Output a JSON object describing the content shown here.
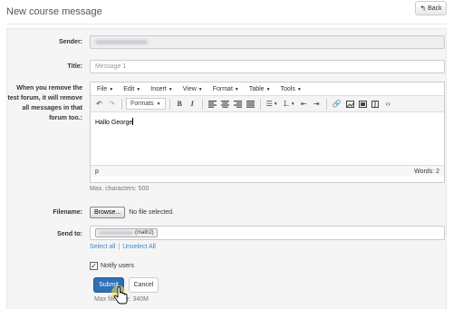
{
  "header": {
    "title": "New course message",
    "back_label": "Back"
  },
  "form": {
    "sender_label": "Sender:",
    "title_label": "Title:",
    "title_placeholder": "Message 1",
    "message_label": "When you remove the test forum, it will remove all messages in that forum too.:",
    "editor": {
      "menus": [
        "File",
        "Edit",
        "Insert",
        "View",
        "Format",
        "Table",
        "Tools"
      ],
      "formats_label": "Formats",
      "content": "Hallo George",
      "path": "p",
      "word_count": "Words: 2"
    },
    "max_chars_hint": "Max. characters: 500",
    "filename_label": "Filename:",
    "browse_label": "Browse...",
    "no_file_text": "No file selected.",
    "send_to_label": "Send to:",
    "recipient_suffix": "(math2)",
    "select_all": "Select all",
    "unselect_all": "Unselect All",
    "notify_label": "Notify users",
    "notify_checked": true,
    "submit_label": "Submit",
    "cancel_label": "Cancel",
    "max_file_hint": "Max file size: 340M"
  }
}
